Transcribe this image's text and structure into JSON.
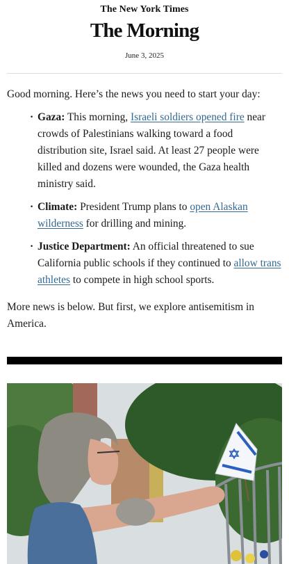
{
  "header": {
    "masthead": "The New York Times",
    "newsletter": "The Morning",
    "date": "June 3, 2025"
  },
  "intro": "Good morning. Here’s the news you need to start your day:",
  "bullets": [
    {
      "label": "Gaza:",
      "pre": " This morning, ",
      "link": "Israeli soldiers opened fire",
      "post": " near crowds of Palestinians walking toward a food distribution site, Israel said. At least 27 people were killed and dozens were wounded, the Gaza health ministry said."
    },
    {
      "label": "Climate:",
      "pre": " President Trump plans to ",
      "link": "open Alaskan wilderness",
      "post": " for drilling and mining."
    },
    {
      "label": "Justice Department:",
      "pre": " An official threatened to sue California public schools if they continued to ",
      "link": "allow trans athletes",
      "post": " to compete in high school sports."
    }
  ],
  "outro": "More news is below. But first, we explore antisemitism in America.",
  "colors": {
    "link": "#326891",
    "text": "#1a1a1a",
    "rule": "#000000"
  },
  "photo": {
    "subject": "woman holding Israeli flag at a fence"
  }
}
